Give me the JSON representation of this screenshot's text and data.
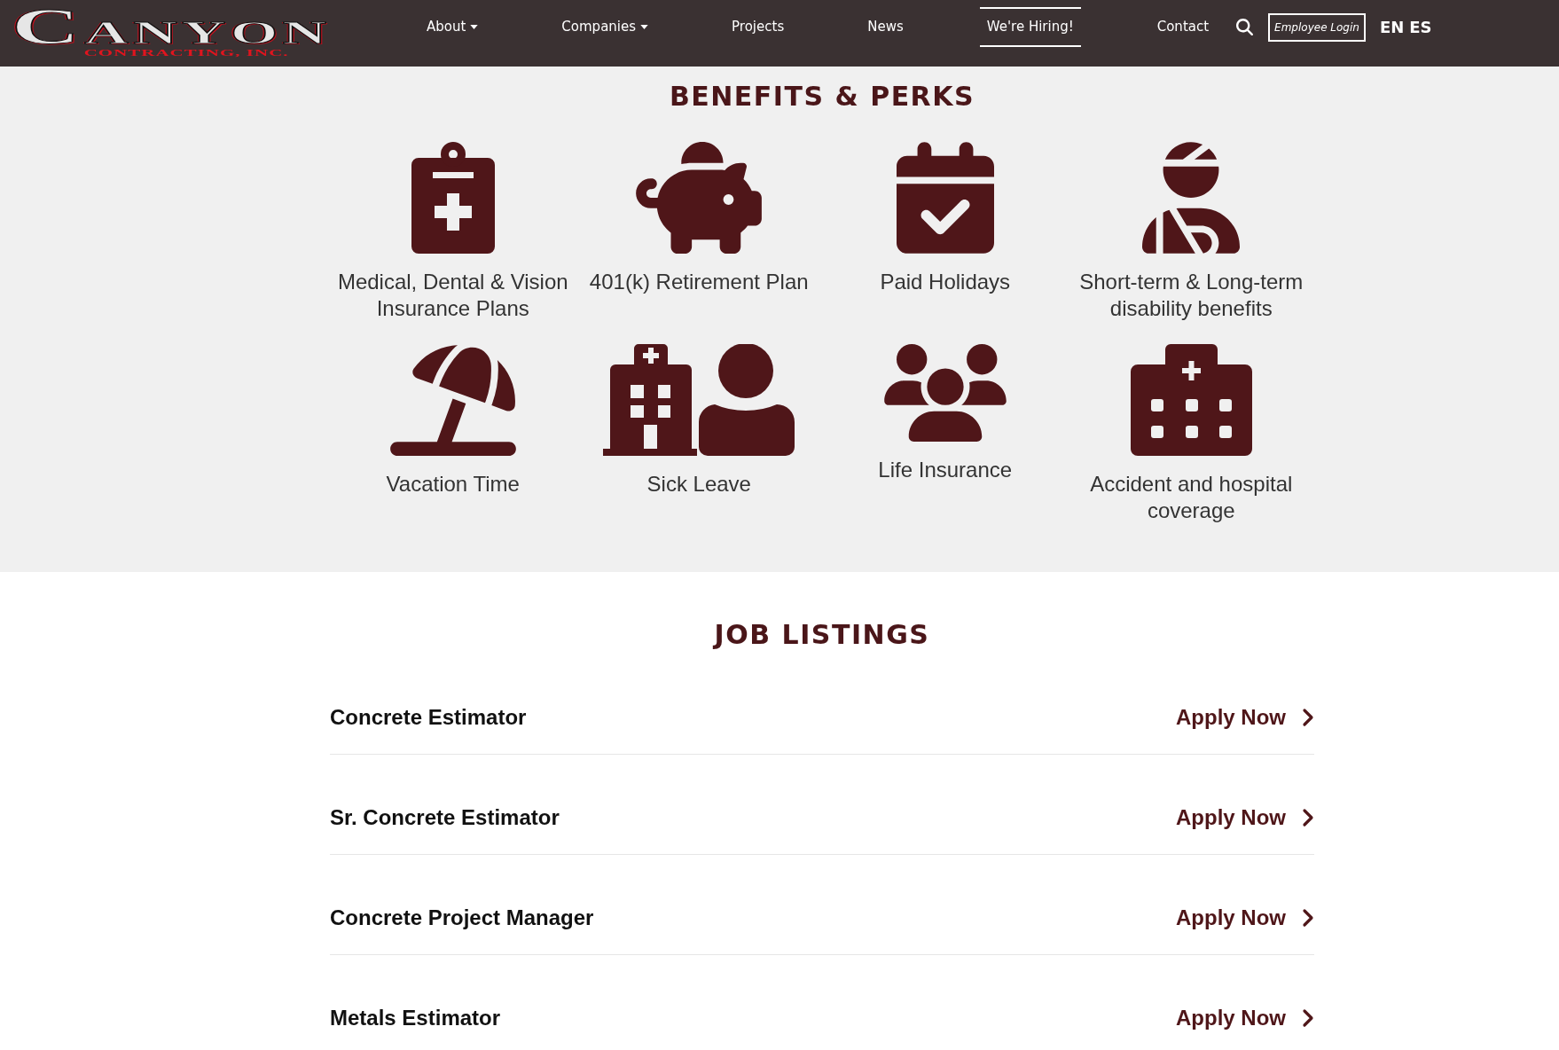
{
  "header": {
    "logo": {
      "name": "CANYON",
      "tagline": "CONTRACTING, INC."
    },
    "nav": [
      {
        "label": "About",
        "selected": false,
        "dropdown": true
      },
      {
        "label": "Companies",
        "selected": false,
        "dropdown": true
      },
      {
        "label": "Projects",
        "selected": false,
        "dropdown": false
      },
      {
        "label": "News",
        "selected": false,
        "dropdown": false
      },
      {
        "label": "We're Hiring!",
        "selected": true,
        "dropdown": false
      },
      {
        "label": "Contact",
        "selected": false,
        "dropdown": false
      }
    ],
    "employee_login": "Employee Login",
    "languages": [
      "EN",
      "ES"
    ]
  },
  "benefits": {
    "title": "BENEFITS & PERKS",
    "items": [
      {
        "label": "Medical, Dental & Vision Insurance Plans"
      },
      {
        "label": "401(k) Retirement Plan"
      },
      {
        "label": "Paid Holidays"
      },
      {
        "label": "Short-term & Long-term disability benefits"
      },
      {
        "label": "Vacation Time"
      },
      {
        "label": "Sick Leave"
      },
      {
        "label": "Life Insurance"
      },
      {
        "label": "Accident and hospital coverage"
      }
    ]
  },
  "job_listings": {
    "title": "JOB LISTINGS",
    "jobs": [
      {
        "title": "Concrete Estimator",
        "action": "Apply Now"
      },
      {
        "title": "Sr. Concrete Estimator",
        "action": "Apply Now"
      },
      {
        "title": "Concrete Project Manager",
        "action": "Apply Now"
      },
      {
        "title": "Metals Estimator",
        "action": "Apply Now"
      }
    ]
  }
}
